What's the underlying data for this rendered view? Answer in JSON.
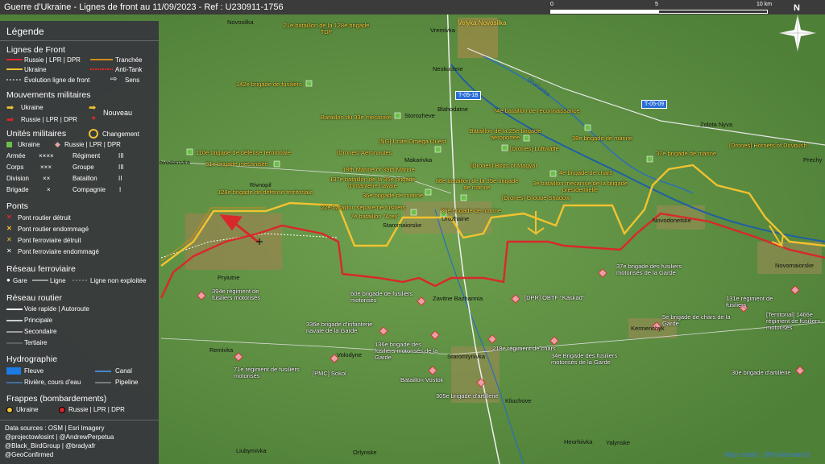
{
  "header": {
    "title": "Guerre d'Ukraine - Lignes de front au 11/09/2023 - Ref : U230911-1756"
  },
  "scale": {
    "labels": [
      "0",
      "5",
      "10 km"
    ]
  },
  "north": {
    "label": "N"
  },
  "legend": {
    "title": "Légende",
    "front_lines": {
      "heading": "Lignes de Front",
      "items": [
        "Russie | LPR | DPR",
        "Tranchée",
        "Ukraine",
        "Anti-Tank",
        "Évolution ligne de front",
        "Sens"
      ]
    },
    "movements": {
      "heading": "Mouvements militaires",
      "ukraine": "Ukraine",
      "russia": "Russie | LPR | DPR",
      "new": "Nouveau"
    },
    "units": {
      "heading": "Unités militaires",
      "change": "Changement",
      "ukraine": "Ukraine",
      "russia": "Russie | LPR | DPR",
      "ranks": [
        [
          "Armée",
          "××××",
          "Régiment",
          "III"
        ],
        [
          "Corps",
          "×××",
          "Groupe",
          "III"
        ],
        [
          "Division",
          "××",
          "Bataillon",
          "II"
        ],
        [
          "Brigade",
          "×",
          "Compagnie",
          "I"
        ]
      ]
    },
    "bridges": {
      "heading": "Ponts",
      "items": [
        "Pont routier détruit",
        "Pont routier endommagé",
        "Pont ferroviaire détruit",
        "Pont ferroviaire endommagé"
      ]
    },
    "rail": {
      "heading": "Réseau ferroviaire",
      "items": [
        "Gare",
        "Ligne",
        "Ligne non exploitée"
      ]
    },
    "road": {
      "heading": "Réseau routier",
      "items": [
        "Voie rapide | Autoroute",
        "Principale",
        "Secondaire",
        "Tertiaire"
      ]
    },
    "hydro": {
      "heading": "Hydrographie",
      "items": [
        "Fleuve",
        "Canal",
        "Rivière, cours d'eau",
        "Pipeline"
      ]
    },
    "strikes": {
      "heading": "Frappes (bombardements)",
      "ukraine": "Ukraine",
      "russia": "Russie | LPR | DPR"
    },
    "sources": [
      "Data sources : OSM | Esri Imagery",
      "@projectowlosint | @AndrewPerpetua",
      "@Black_BirdGroup | @bradyafr",
      "@GeoConfirmed"
    ]
  },
  "towns": [
    "Novosilka",
    "Vremivka",
    "Neskuchne",
    "Blahodatne",
    "Storozheve",
    "Makarivka",
    "Rivnopil",
    "Staromaiorske",
    "Urozhaine",
    "Pryiutne",
    "Zavitne Bazhannia",
    "Novodonetske",
    "Novomaiorske",
    "Zolota Nyva",
    "Prechy",
    "Kermenchyk",
    "Volodyne",
    "Rivnopil",
    "Staromlynivka",
    "Kliuchove",
    "Heorhiivka",
    "Yalynske",
    "Liubymivka",
    "Orlynske",
    "ovodanivka",
    "Remivka"
  ],
  "big_town": "Velyka Novosilka",
  "road_badges": [
    "T-05-18",
    "T-05-09"
  ],
  "river": "Shaitanka",
  "ua_units": [
    "21e bataillon de la 128e brigade TDF",
    "142e brigade de fusiliers",
    "Bataillon du 93e mécanisé",
    "74e bataillon de reconnaissance",
    "Bataillon de la 25e brigade aéroportée",
    "38e brigade de marine",
    "[Drones] Luftwaffe",
    "[Drones] Hornets of Dovbush",
    "110e brigade de défense territoriale",
    "[NG] Unité Omega Ouest",
    "[Drones] Aéronautes",
    "37e brigade de marine",
    "31e brigade mécanisée",
    "[Drones] Birds of Magyar",
    "18th Marine of 35th Marine",
    "4e brigade de chars",
    "137e bataillon de la 35e brigade d'infanterie navale",
    "88e bataillon de la 35e brigade de marine",
    "3e bataillon mécanisé de la brigade présidentielle",
    "128e brigade de défense territoriale",
    "36e brigade de marine",
    "[Drones] Groupe Shadow",
    "22e bataillon séparé de fusiliers",
    "35e brigade de marine",
    "7e bataillon \"Arey\""
  ],
  "ru_units": [
    "37e brigade des fusiliers motorisés de la Garde",
    "394e régiment de fusiliers motorisés",
    "60e brigade de fusiliers motorisés",
    "[DPR] OBTF \"Kaskad\"",
    "131e régiment de fusiliers",
    "[Territorial] 1466e régiment de fusiliers motorisés",
    "5e brigade de chars de la Garde",
    "336e brigade d'infanterie navale de la Garde",
    "136e brigade des fusiliers motorisés de la Garde",
    "218e régiment de chars",
    "34e Brigade des fusiliers motorisés de la Garde",
    "71e régiment de fusiliers motorisés",
    "[PMC] Sokol",
    "Bataillon Vostok",
    "30e brigade d'artillerie",
    "305e brigade d'artillerie"
  ],
  "credits": "Map credits : @Pouletvolant3",
  "colors": {
    "russia": "#d9282a",
    "ukraine": "#f2c230",
    "trench": "#d08a1a",
    "legend_bg": "#37373c",
    "map": "#5e8f42"
  }
}
